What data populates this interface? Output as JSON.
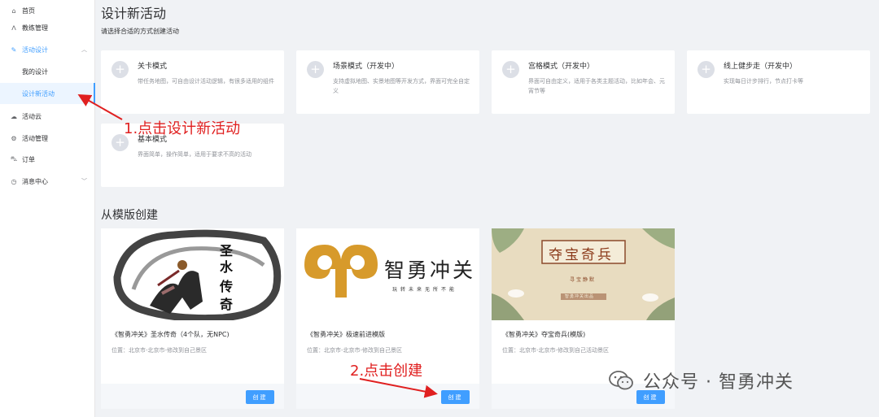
{
  "sidebar": {
    "items": [
      {
        "label": "首页",
        "icon": "home-icon"
      },
      {
        "label": "教练管理",
        "icon": "coach-icon"
      },
      {
        "label": "活动设计",
        "icon": "design-icon"
      },
      {
        "label": "我的设计"
      },
      {
        "label": "设计新活动"
      },
      {
        "label": "活动云",
        "icon": "cloud-icon"
      },
      {
        "label": "活动管理",
        "icon": "manage-icon"
      },
      {
        "label": "订单",
        "icon": "cart-icon"
      },
      {
        "label": "消息中心",
        "icon": "message-icon"
      }
    ]
  },
  "main": {
    "title": "设计新活动",
    "subtitle": "请选择合适的方式创建活动",
    "modes": [
      {
        "name": "关卡模式",
        "desc": "带任务地图，可自由设计活动逻辑，有很多适用的组件"
      },
      {
        "name": "场景模式（开发中）",
        "desc": "支持虚拟地图、实景地图等开发方式，界面可完全自定义"
      },
      {
        "name": "宫格模式（开发中）",
        "desc": "界面可自由定义，适用于各类主题活动，比如年会、元宵节等"
      },
      {
        "name": "线上健步走（开发中）",
        "desc": "实现每日计步排行，节点打卡等"
      },
      {
        "name": "基本模式",
        "desc": "界面简单，操作简单，适用于要求不高的活动"
      }
    ],
    "template_section_title": "从模版创建",
    "templates": [
      {
        "title": "《智勇冲关》圣水传奇（4个队，无NPC)",
        "location": "位置：北京市-北京市-修改到自己景区",
        "button": "创建",
        "image_text": [
          "圣",
          "水",
          "传",
          "奇"
        ]
      },
      {
        "title": "《智勇冲关》极速前进模版",
        "location": "位置：北京市-北京市-修改到自己景区",
        "button": "创建",
        "image_text": [
          "智勇冲关",
          "玩转未来无所不能"
        ]
      },
      {
        "title": "《智勇冲关》夺宝奇兵(模版)",
        "location": "位置：北京市-北京市-修改到自己活动景区",
        "button": "创建",
        "image_text": [
          "夺宝奇兵",
          "寻宝静默",
          "智勇冲关出品"
        ]
      }
    ]
  },
  "annotations": {
    "step1": "1.点击设计新活动",
    "step2": "2.点击创建",
    "color": "#e02020"
  },
  "watermark": "公众号 · 智勇冲关",
  "colors": {
    "accent": "#409eff",
    "annotation": "#e02020"
  }
}
